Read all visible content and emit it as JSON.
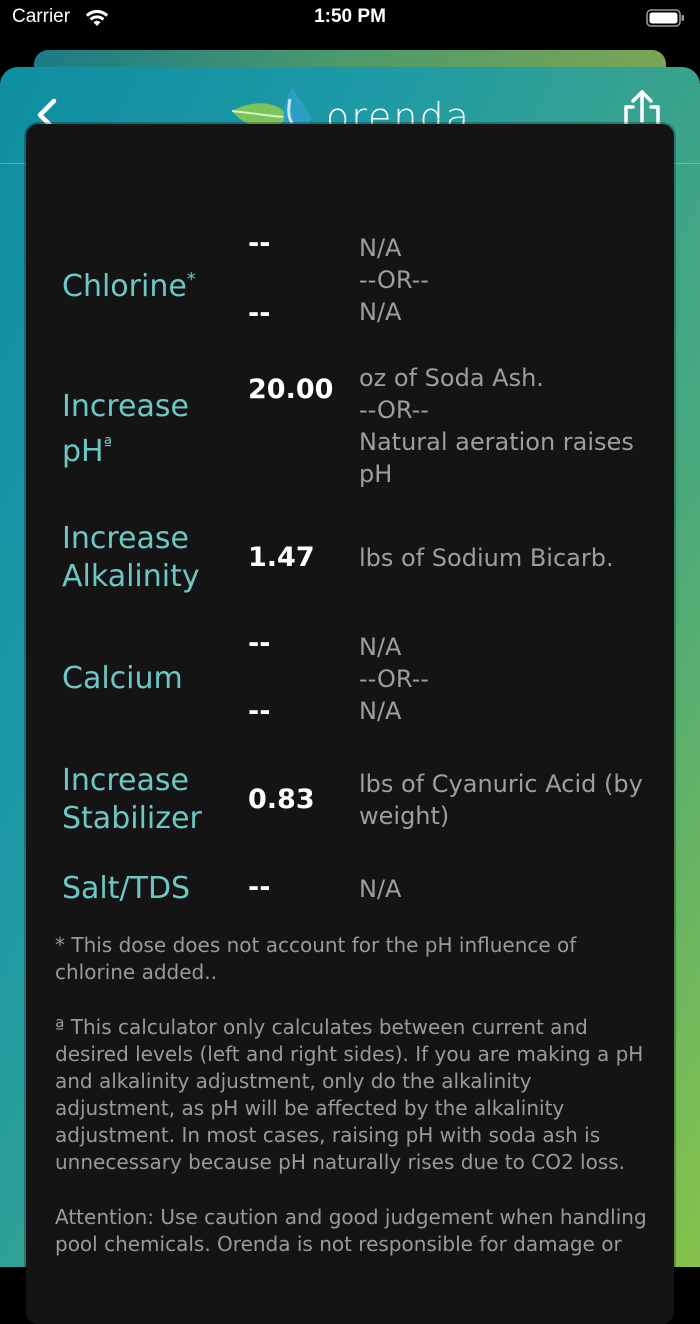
{
  "status": {
    "carrier": "Carrier",
    "time": "1:50 PM"
  },
  "app": {
    "logo_text": "orenda"
  },
  "icons": {
    "back": "chevron-left-icon",
    "share": "share-icon",
    "wifi": "wifi-icon",
    "battery": "battery-icon"
  },
  "colors": {
    "label": "#6cc8c4",
    "card": "#141414",
    "gradient_start": "#0f8ea1",
    "gradient_end": "#86c24a"
  },
  "rows": [
    {
      "label": "Chlorine",
      "mark": "*",
      "amounts": [
        "--",
        "--"
      ],
      "lines": [
        "N/A",
        "--OR--",
        "N/A"
      ]
    },
    {
      "label": "Increase pH",
      "mark": "ª",
      "amounts": [
        "20.00"
      ],
      "lines": [
        "oz of Soda Ash.",
        "--OR--",
        "Natural aeration raises",
        "pH"
      ]
    },
    {
      "label_lines": [
        "Increase",
        "Alkalinity"
      ],
      "amounts": [
        "1.47"
      ],
      "lines": [
        "lbs of Sodium Bicarb."
      ]
    },
    {
      "label": "Calcium",
      "amounts": [
        "--",
        "--"
      ],
      "lines": [
        "N/A",
        "--OR--",
        "N/A"
      ]
    },
    {
      "label_lines": [
        "Increase",
        "Stabilizer"
      ],
      "amounts": [
        "0.83"
      ],
      "lines": [
        "lbs of Cyanuric Acid (by",
        "weight)"
      ]
    },
    {
      "label": "Salt/TDS",
      "amounts": [
        "--"
      ],
      "lines": [
        "N/A"
      ]
    }
  ],
  "notes": [
    "* This dose does not account for the pH influence of chlorine added..",
    "ª This calculator only calculates between current and desired levels (left and right sides). If you are making a pH and alkalinity adjustment, only do the alkalinity adjustment, as pH will be affected by the alkalinity adjustment. In most cases, raising pH with soda ash is unnecessary because pH naturally rises due to CO2 loss.",
    "Attention: Use caution and good judgement when handling pool chemicals. Orenda is not responsible for damage or"
  ]
}
